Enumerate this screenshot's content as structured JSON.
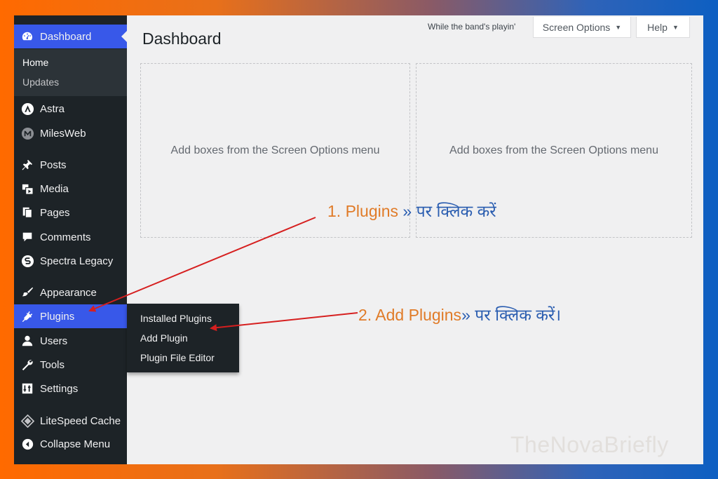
{
  "sidebar": {
    "dashboard": {
      "label": "Dashboard",
      "icon": "dashboard-gauge-icon"
    },
    "submenu": [
      {
        "label": "Home"
      },
      {
        "label": "Updates"
      }
    ],
    "items": [
      {
        "label": "Astra",
        "icon": "astra-logo-icon"
      },
      {
        "label": "MilesWeb",
        "icon": "milesweb-logo-icon"
      },
      {
        "label": "Posts",
        "icon": "pushpin-icon"
      },
      {
        "label": "Media",
        "icon": "media-icon"
      },
      {
        "label": "Pages",
        "icon": "pages-icon"
      },
      {
        "label": "Comments",
        "icon": "comment-bubble-icon"
      },
      {
        "label": "Spectra Legacy",
        "icon": "spectra-logo-icon"
      },
      {
        "label": "Appearance",
        "icon": "paintbrush-icon"
      },
      {
        "label": "Plugins",
        "icon": "plug-icon"
      },
      {
        "label": "Users",
        "icon": "user-icon"
      },
      {
        "label": "Tools",
        "icon": "wrench-icon"
      },
      {
        "label": "Settings",
        "icon": "settings-sliders-icon"
      },
      {
        "label": "LiteSpeed Cache",
        "icon": "litespeed-diamond-icon"
      },
      {
        "label": "Collapse Menu",
        "icon": "collapse-arrow-icon"
      }
    ]
  },
  "plugins_flyout": [
    {
      "label": "Installed Plugins"
    },
    {
      "label": "Add Plugin"
    },
    {
      "label": "Plugin File Editor"
    }
  ],
  "header": {
    "title": "Dashboard",
    "tagline": "While the band's playin'",
    "screen_options": "Screen Options",
    "help": "Help"
  },
  "boxes": [
    {
      "text": "Add boxes from the Screen Options menu"
    },
    {
      "text": "Add boxes from the Screen Options menu"
    }
  ],
  "annotations": {
    "step1_prefix": "1. Plugins",
    "step1_suffix": " » पर क्लिक करें",
    "step2_prefix": "2. Add Plugins",
    "step2_suffix": "» पर क्लिक करें।"
  },
  "watermark": "TheNovaBriefly",
  "colors": {
    "sidebar_bg": "#1d2327",
    "active_bg": "#3858e9",
    "arrow": "#d61f1f",
    "annotation_orange": "#e07b28",
    "annotation_blue": "#2a5db0"
  }
}
